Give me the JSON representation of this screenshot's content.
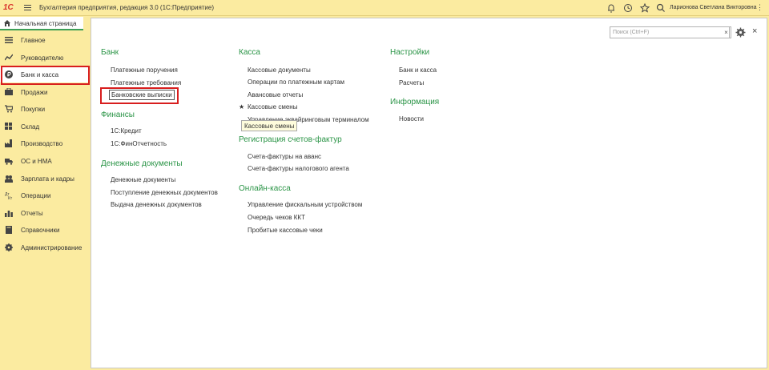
{
  "window": {
    "title": "Бухгалтерия предприятия, редакция 3.0  (1С:Предприятие)",
    "logo": "1С",
    "user": "Ларионова Светлана Викторовна",
    "more": "⋮"
  },
  "tabs": {
    "home": "Начальная страница"
  },
  "sidebar": {
    "items": [
      {
        "label": "Главное",
        "icon": "list-icon"
      },
      {
        "label": "Руководителю",
        "icon": "chart-icon"
      },
      {
        "label": "Банк и касса",
        "icon": "ruble-coin-icon"
      },
      {
        "label": "Продажи",
        "icon": "sales-icon"
      },
      {
        "label": "Покупки",
        "icon": "cart-icon"
      },
      {
        "label": "Склад",
        "icon": "warehouse-icon"
      },
      {
        "label": "Производство",
        "icon": "factory-icon"
      },
      {
        "label": "ОС и НМА",
        "icon": "truck-icon"
      },
      {
        "label": "Зарплата и кадры",
        "icon": "people-icon"
      },
      {
        "label": "Операции",
        "icon": "operations-icon"
      },
      {
        "label": "Отчеты",
        "icon": "bar-chart-icon"
      },
      {
        "label": "Справочники",
        "icon": "book-icon"
      },
      {
        "label": "Администрирование",
        "icon": "gear-icon"
      }
    ]
  },
  "search": {
    "placeholder": "Поиск (Ctrl+F)",
    "clear": "×"
  },
  "close": "×",
  "sections": {
    "bank": {
      "title": "Банк",
      "links": [
        "Платежные поручения",
        "Платежные требования",
        "Банковские выписки"
      ]
    },
    "finance": {
      "title": "Финансы",
      "links": [
        "1С:Кредит",
        "1С:ФинОтчетность"
      ]
    },
    "money_docs": {
      "title": "Денежные документы",
      "links": [
        "Денежные документы",
        "Поступление денежных документов",
        "Выдача денежных документов"
      ]
    },
    "kassa": {
      "title": "Касса",
      "links": [
        "Кассовые документы",
        "Операции по платежным картам",
        "Авансовые отчеты",
        "Кассовые смены",
        "Управление эквайринговым терминалом"
      ]
    },
    "invoices": {
      "title": "Регистрация счетов-фактур",
      "links": [
        "Счета-фактуры на аванс",
        "Счета-фактуры налогового агента"
      ]
    },
    "online_kassa": {
      "title": "Онлайн-касса",
      "links": [
        "Управление фискальным устройством",
        "Очередь чеков ККТ",
        "Пробитые кассовые чеки"
      ]
    },
    "settings": {
      "title": "Настройки",
      "links": [
        "Банк и касса",
        "Расчеты"
      ]
    },
    "info": {
      "title": "Информация",
      "links": [
        "Новости"
      ]
    }
  },
  "tooltip": "Кассовые смены",
  "star": "★"
}
